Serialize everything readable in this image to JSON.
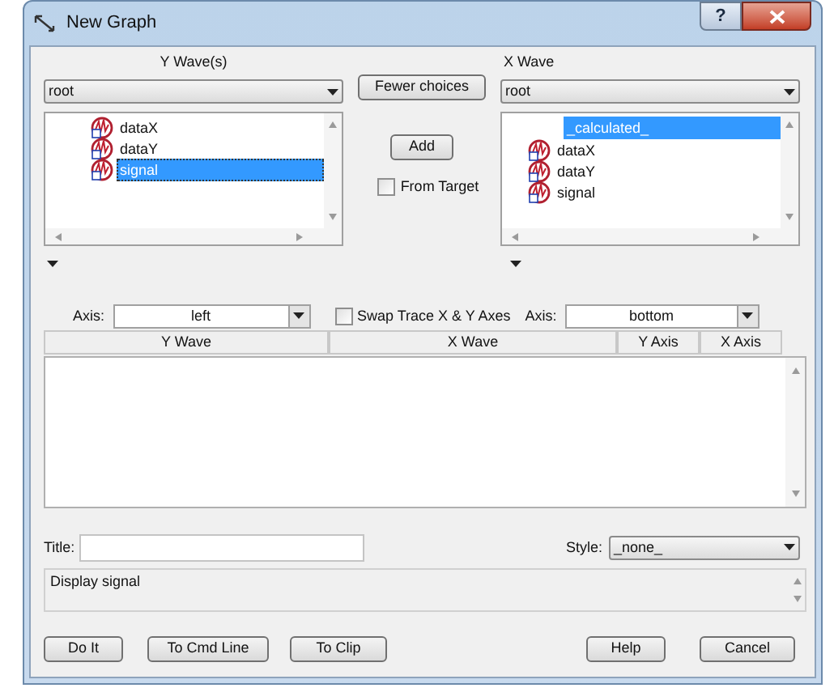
{
  "window": {
    "title": "New Graph",
    "help_glyph": "?"
  },
  "y_waves": {
    "label": "Y Wave(s)",
    "folder": "root",
    "items": [
      {
        "name": "dataX",
        "kind": "wave",
        "selected": false
      },
      {
        "name": "dataY",
        "kind": "wave",
        "selected": false
      },
      {
        "name": "signal",
        "kind": "wave",
        "selected": true
      }
    ]
  },
  "fewer_choices_button": "Fewer choices",
  "add_button": "Add",
  "from_target": {
    "label": "From Target",
    "checked": false
  },
  "x_wave": {
    "label": "X Wave",
    "folder": "root",
    "items": [
      {
        "name": "_calculated_",
        "kind": "special",
        "selected": true
      },
      {
        "name": "dataX",
        "kind": "wave",
        "selected": false
      },
      {
        "name": "dataY",
        "kind": "wave",
        "selected": false
      },
      {
        "name": "signal",
        "kind": "wave",
        "selected": false
      }
    ]
  },
  "y_axis": {
    "label": "Axis:",
    "value": "left"
  },
  "swap": {
    "label": "Swap Trace X & Y Axes",
    "checked": false
  },
  "x_axis": {
    "label": "Axis:",
    "value": "bottom"
  },
  "table": {
    "columns": [
      "Y Wave",
      "X Wave",
      "Y Axis",
      "X Axis"
    ]
  },
  "title_field": {
    "label": "Title:"
  },
  "style": {
    "label": "Style:",
    "value": "_none_"
  },
  "status": "Display signal",
  "buttons": [
    "Do It",
    "To Cmd Line",
    "To Clip",
    "Help",
    "Cancel"
  ]
}
